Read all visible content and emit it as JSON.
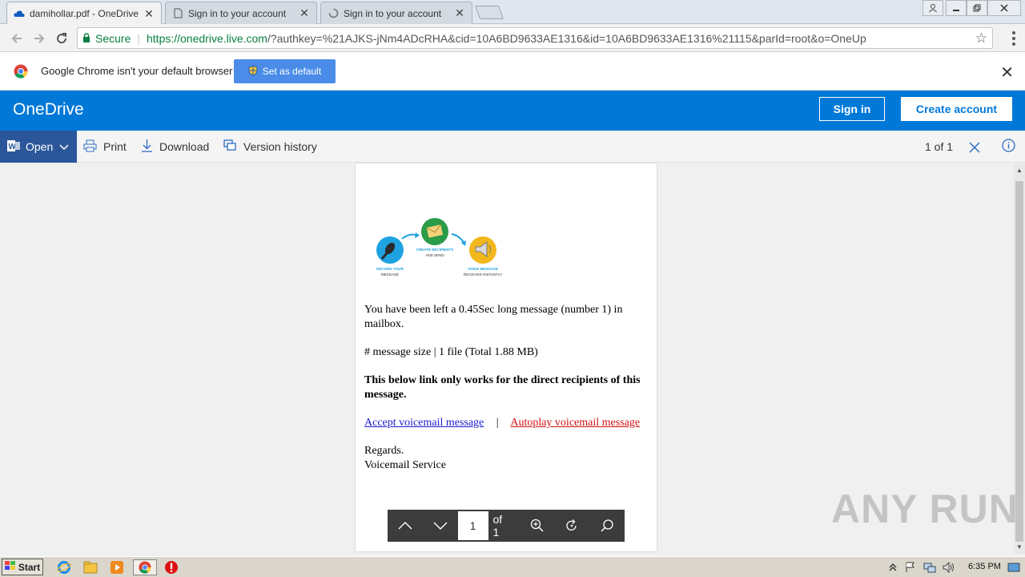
{
  "browser": {
    "tabs": [
      {
        "title": "damihollar.pdf - OneDrive",
        "active": true
      },
      {
        "title": "Sign in to your account",
        "active": false
      },
      {
        "title": "Sign in to your account",
        "active": false
      }
    ],
    "address": {
      "secure_label": "Secure",
      "url_scheme_host": "https://onedrive.live.com",
      "url_rest": "/?authkey=%21AJKS-jNm4ADcRHA&cid=10A6BD9633AE1316&id=10A6BD9633AE1316%21115&parId=root&o=OneUp"
    },
    "infobar": {
      "message": "Google Chrome isn't your default browser",
      "button": "Set as default"
    }
  },
  "onedrive": {
    "brand": "OneDrive",
    "sign_in": "Sign in",
    "create_account": "Create account",
    "commands": {
      "open": "Open",
      "print": "Print",
      "download": "Download",
      "version_history": "Version history"
    },
    "page_count": "1 of 1"
  },
  "document": {
    "flow": {
      "step1_line1": "RECORD YOUR",
      "step1_line2": "MESSAGE",
      "step2_line1": "CREATE RECIPIENTS",
      "step2_line2": "AND SEND",
      "step3_line1": "VOICE MESSAGE",
      "step3_line2": "RECEIVED INSTANTLY"
    },
    "para1": "You have been left a 0.45Sec long message (number 1) in mailbox.",
    "para2": "# message size | 1 file (Total 1.88 MB)",
    "para3": "This below link only works for the direct recipients of this message.",
    "link_accept": "Accept voicemail message",
    "link_sep": "|",
    "link_autoplay": "Autoplay voicemail message",
    "regards": "Regards.",
    "signature": "Voicemail Service"
  },
  "pager": {
    "current_page": "1",
    "of_label": "of 1"
  },
  "watermark": "ANY RUN",
  "taskbar": {
    "start": "Start",
    "clock": "6:35 PM"
  },
  "colors": {
    "onedrive_blue": "#0078d7",
    "word_blue": "#2b579a",
    "chrome_button": "#4a8ce8"
  }
}
